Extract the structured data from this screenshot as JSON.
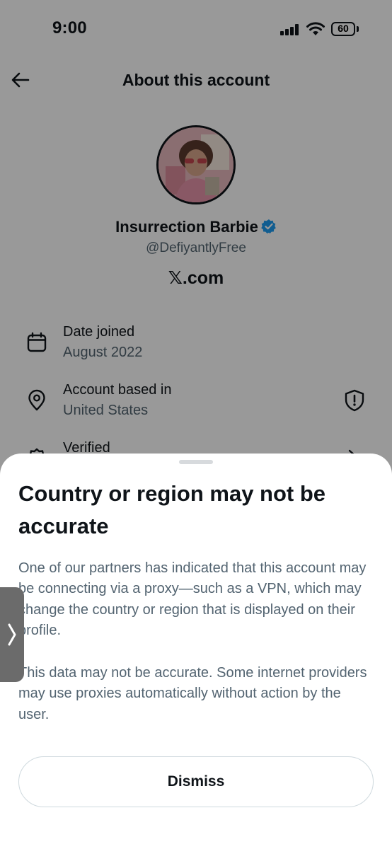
{
  "status_bar": {
    "time": "9:00",
    "battery": "60"
  },
  "header": {
    "title": "About this account"
  },
  "profile": {
    "name": "Insurrection Barbie",
    "handle": "@DefiyantlyFree",
    "platform": "𝕏.com"
  },
  "rows": [
    {
      "title": "Date joined",
      "subtitle": "August 2022",
      "icon": "calendar-icon"
    },
    {
      "title": "Account based in",
      "subtitle": "United States",
      "icon": "location-pin-icon"
    },
    {
      "title": "Verified",
      "icon": "verified-badge-icon"
    }
  ],
  "sheet": {
    "title": "Country or region may not be accurate",
    "paragraph1": "One of our partners has indicated that this account may be connecting via a proxy—such as a VPN, which may change the country or region that is displayed on their profile.",
    "paragraph2": "This data may not be accurate. Some internet providers may use proxies automatically without action by the user.",
    "dismiss_label": "Dismiss"
  },
  "colors": {
    "text": "#0f1419",
    "secondary_text": "#536471",
    "verified_blue": "#1d9bf0",
    "overlay": "rgba(0,0,0,0.4)"
  }
}
